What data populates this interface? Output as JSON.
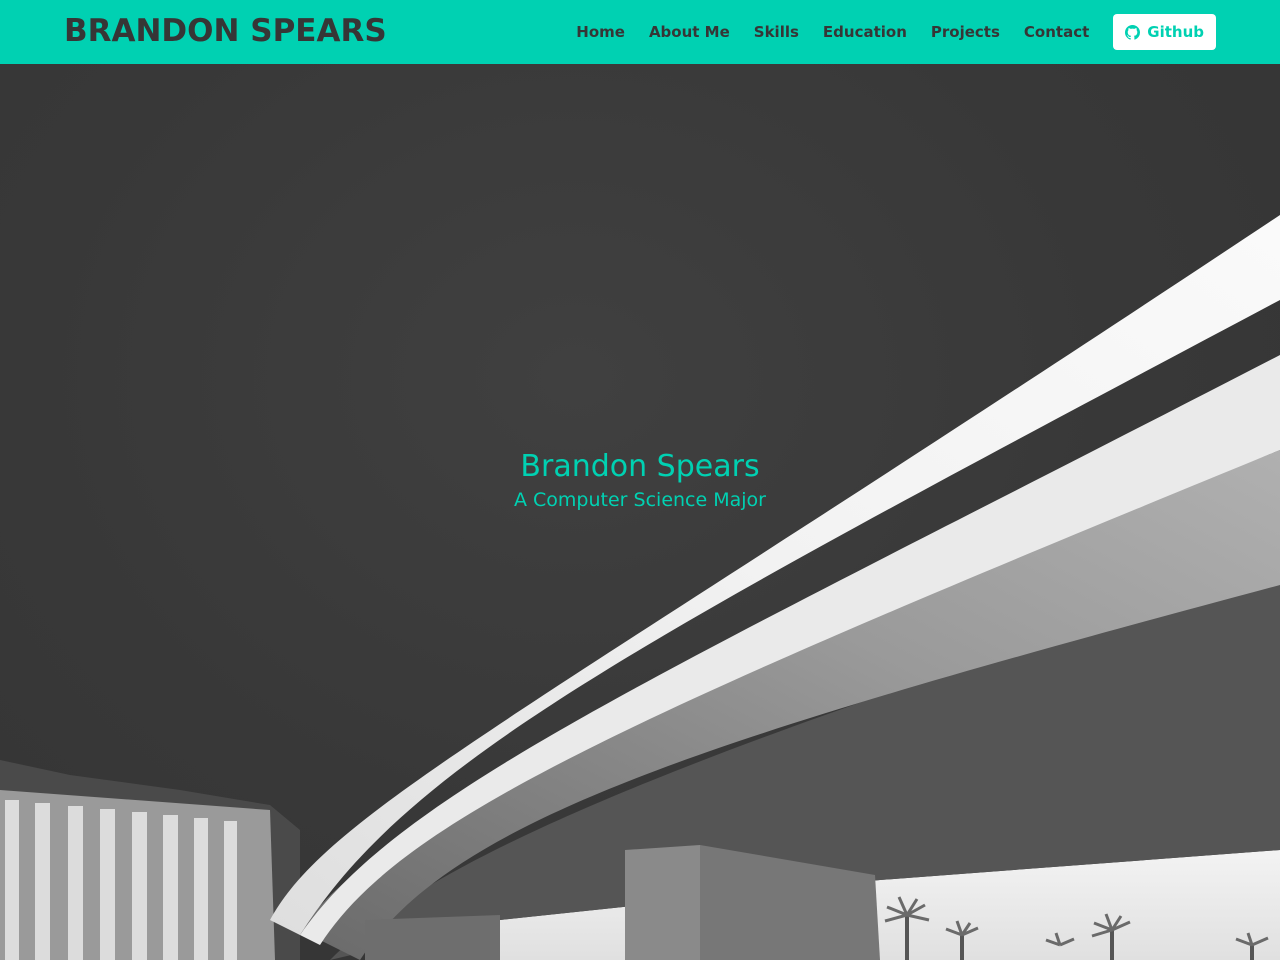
{
  "brand": {
    "name": "BRANDON SPEARS"
  },
  "nav": {
    "items": [
      {
        "label": "Home"
      },
      {
        "label": "About Me"
      },
      {
        "label": "Skills"
      },
      {
        "label": "Education"
      },
      {
        "label": "Projects"
      },
      {
        "label": "Contact"
      }
    ],
    "github": {
      "label": "Github",
      "icon": "github-icon"
    }
  },
  "hero": {
    "title": "Brandon Spears",
    "subtitle": "A Computer Science Major",
    "background_image": "grayscale photo of curved concrete overpass from below"
  },
  "colors": {
    "primary": "#00d1b2",
    "nav_text": "#363636",
    "hero_background": "#3a3a3a",
    "github_button_bg": "#ffffff"
  }
}
